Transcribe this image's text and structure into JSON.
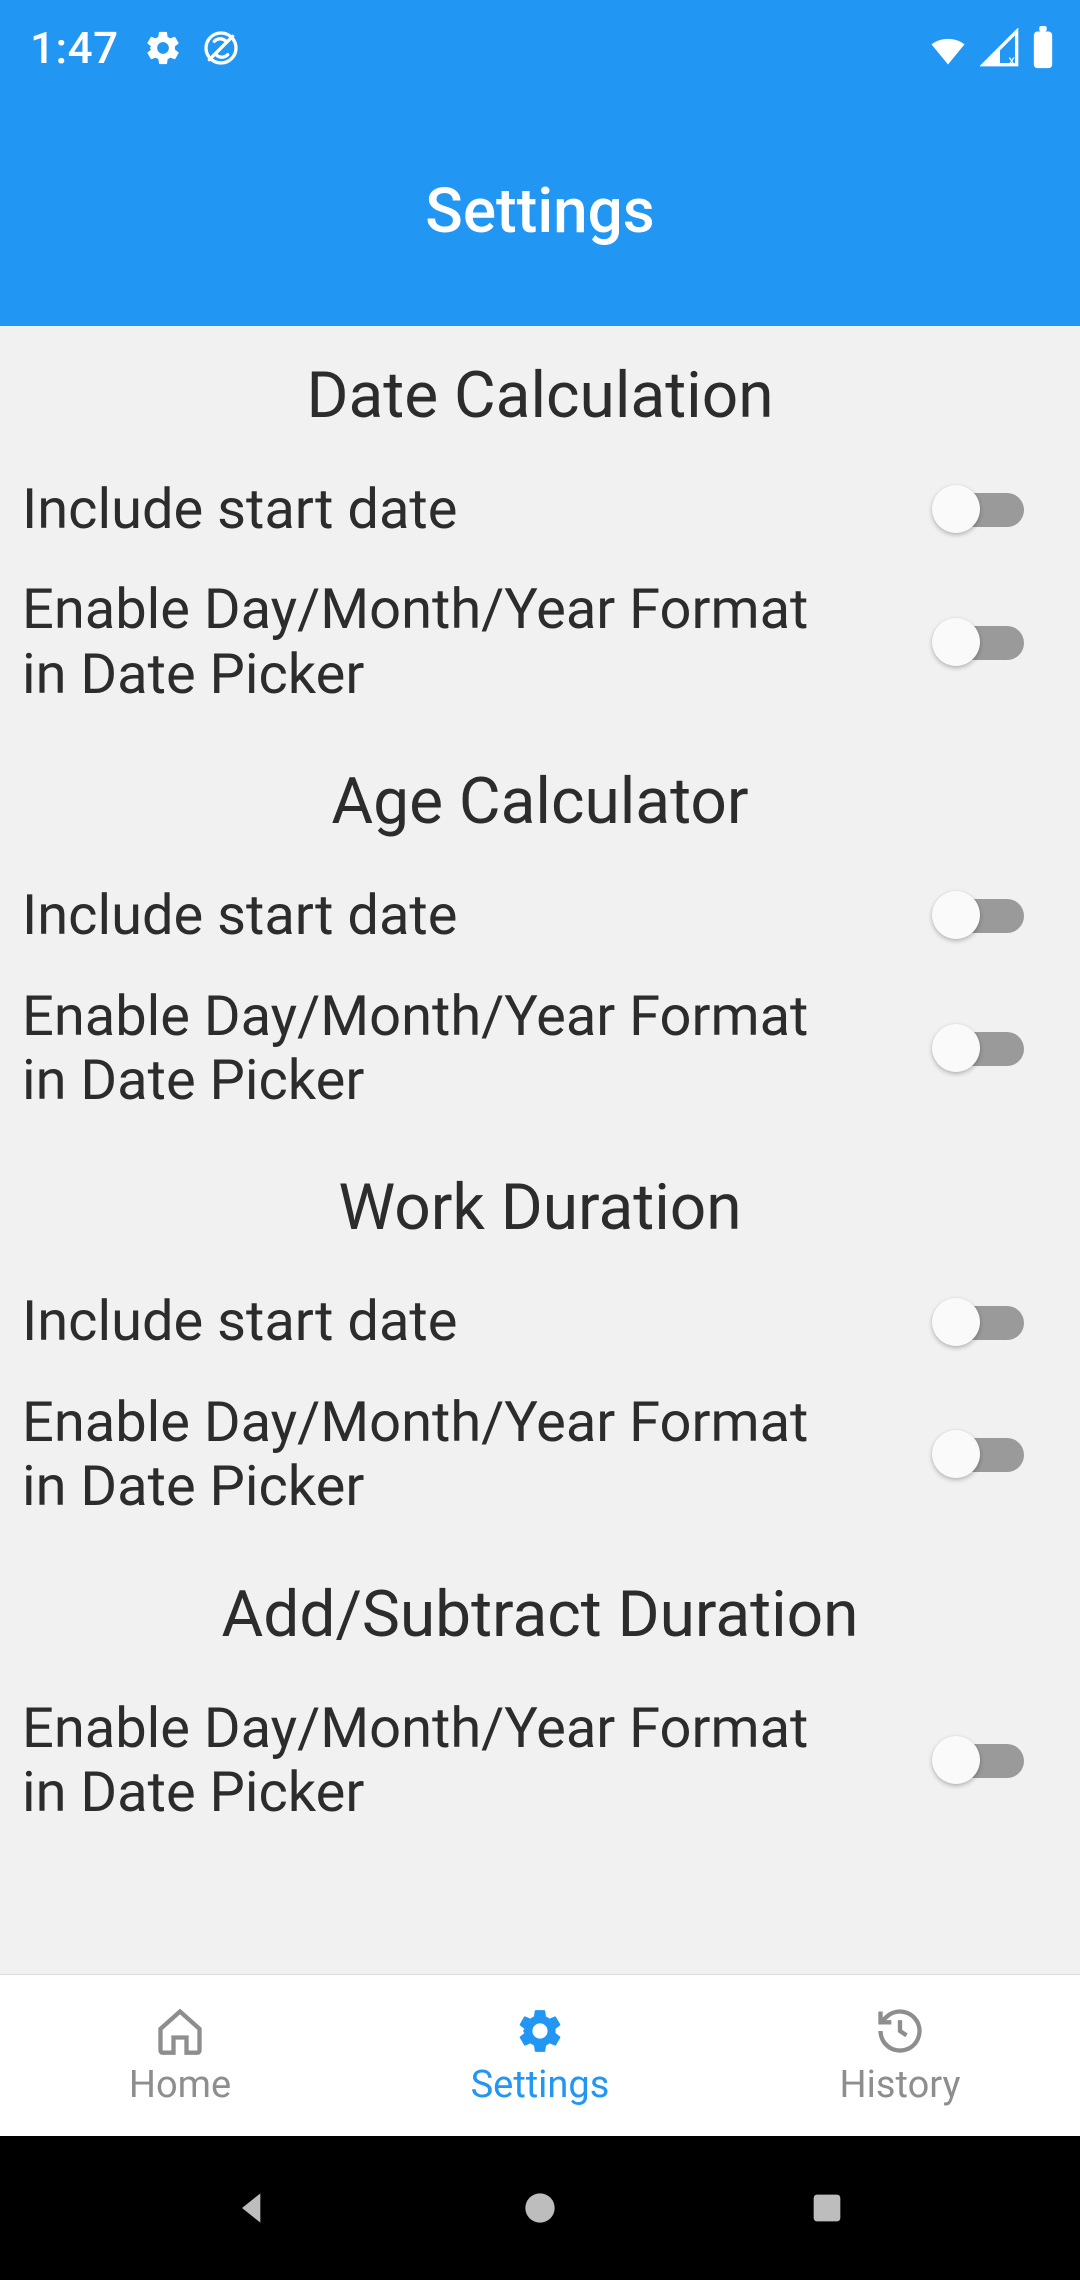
{
  "status": {
    "time": "1:47"
  },
  "header": {
    "title": "Settings"
  },
  "sections": [
    {
      "title": "Date Calculation",
      "rows": [
        {
          "label": "Include start date"
        },
        {
          "label": "Enable Day/Month/Year Format in Date Picker"
        }
      ]
    },
    {
      "title": "Age Calculator",
      "rows": [
        {
          "label": "Include start date"
        },
        {
          "label": "Enable Day/Month/Year Format in Date Picker"
        }
      ]
    },
    {
      "title": "Work Duration",
      "rows": [
        {
          "label": "Include start date"
        },
        {
          "label": "Enable Day/Month/Year Format in Date Picker"
        }
      ]
    },
    {
      "title": "Add/Subtract Duration",
      "rows": [
        {
          "label": "Enable Day/Month/Year Format in Date Picker"
        }
      ]
    }
  ],
  "bottom_nav": {
    "items": [
      {
        "label": "Home"
      },
      {
        "label": "Settings"
      },
      {
        "label": "History"
      }
    ],
    "active_index": 1
  },
  "colors": {
    "primary": "#2196F3",
    "text": "#2c2c2c",
    "muted": "#8e8e8e"
  }
}
